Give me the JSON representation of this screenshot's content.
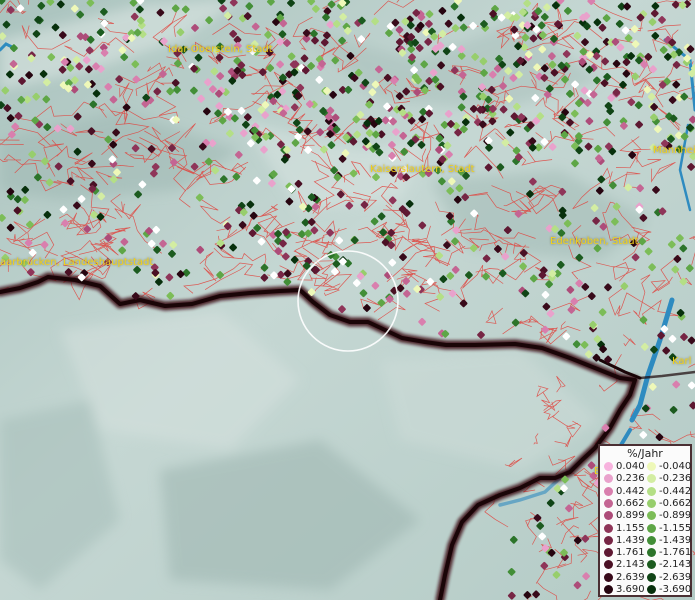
{
  "map": {
    "cities": [
      {
        "id": "idar-oberstein",
        "label": "Idar-Oberstein, Stadt"
      },
      {
        "id": "kaiserslautern",
        "label": "Kaiserslautern, Stadt"
      },
      {
        "id": "edenkoben",
        "label": "Edenkoben, Stadt"
      },
      {
        "id": "saarbruecken",
        "label": "aarbrücken, Landeshauptstadt"
      },
      {
        "id": "mannheim",
        "label": "Mannhei"
      },
      {
        "id": "karlsruhe",
        "label": "Karl"
      },
      {
        "id": "b-edge",
        "label": "B"
      }
    ],
    "colors": {
      "terrain": "#b9cfcc",
      "boundary": "#e0443e",
      "border_dark": "#2a0c10",
      "river": "#2e8bc0",
      "highlight_ring": "#ffffff"
    }
  },
  "legend": {
    "title": "%/Jahr",
    "positive": [
      {
        "value": "0.040",
        "color": "#f7b3de"
      },
      {
        "value": "0.236",
        "color": "#e9a2cc"
      },
      {
        "value": "0.442",
        "color": "#d97fae"
      },
      {
        "value": "0.662",
        "color": "#c46593"
      },
      {
        "value": "0.899",
        "color": "#ad4c79"
      },
      {
        "value": "1.155",
        "color": "#8f3559"
      },
      {
        "value": "1.439",
        "color": "#762544"
      },
      {
        "value": "1.761",
        "color": "#5e1832"
      },
      {
        "value": "2.143",
        "color": "#4a1024"
      },
      {
        "value": "2.639",
        "color": "#380a1a"
      },
      {
        "value": "3.690",
        "color": "#260510"
      }
    ],
    "negative": [
      {
        "value": "-0.040",
        "color": "#eef8b8"
      },
      {
        "value": "-0.236",
        "color": "#d3eda2"
      },
      {
        "value": "-0.442",
        "color": "#b4df86"
      },
      {
        "value": "-0.662",
        "color": "#97ce6c"
      },
      {
        "value": "-0.899",
        "color": "#7cbd58"
      },
      {
        "value": "-1.155",
        "color": "#5ea646"
      },
      {
        "value": "-1.439",
        "color": "#428e37"
      },
      {
        "value": "-1.761",
        "color": "#2c742a"
      },
      {
        "value": "-2.143",
        "color": "#1c5b1f"
      },
      {
        "value": "-2.639",
        "color": "#104416"
      },
      {
        "value": "-3.690",
        "color": "#07300c"
      }
    ],
    "extra_point_color": "#ffffff"
  }
}
